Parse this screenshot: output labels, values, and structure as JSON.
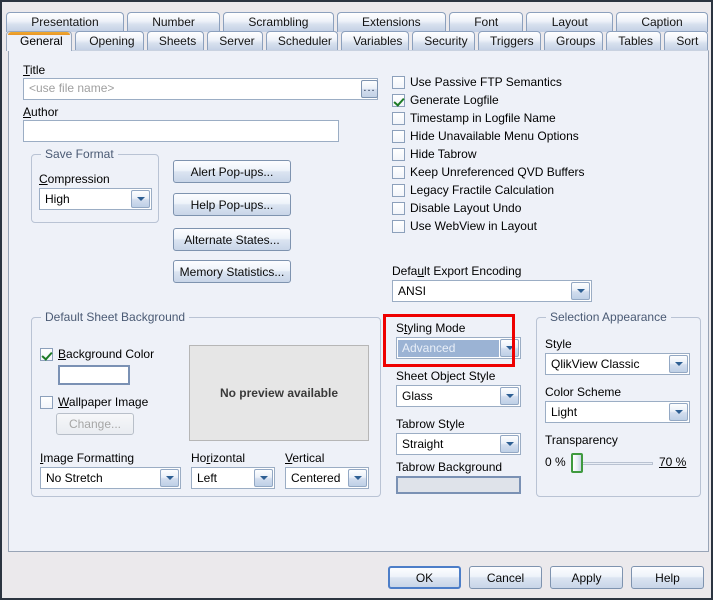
{
  "window": {
    "tabs_row_top": [
      "Presentation",
      "Number",
      "Scrambling",
      "Extensions",
      "Font",
      "Layout",
      "Caption"
    ],
    "tabs_row_bottom": [
      "General",
      "Opening",
      "Sheets",
      "Server",
      "Scheduler",
      "Variables",
      "Security",
      "Triggers",
      "Groups",
      "Tables",
      "Sort"
    ],
    "active_tab": "General"
  },
  "general": {
    "title_label": "Title",
    "title_value": "<use file name>",
    "title_browse": "...",
    "author_label": "Author",
    "author_value": "",
    "save_format": {
      "group_title": "Save Format",
      "compression_label": "Compression",
      "compression_value": "High"
    },
    "buttons": [
      "Alert Pop-ups...",
      "Help Pop-ups...",
      "Alternate States...",
      "Memory Statistics..."
    ],
    "checkboxes": [
      {
        "label": "Use Passive FTP Semantics",
        "checked": false
      },
      {
        "label": "Generate Logfile",
        "checked": true
      },
      {
        "label": "Timestamp in Logfile Name",
        "checked": false
      },
      {
        "label": "Hide Unavailable Menu Options",
        "checked": false
      },
      {
        "label": "Hide Tabrow",
        "checked": false
      },
      {
        "label": "Keep Unreferenced QVD Buffers",
        "checked": false
      },
      {
        "label": "Legacy Fractile Calculation",
        "checked": false
      },
      {
        "label": "Disable Layout Undo",
        "checked": false
      },
      {
        "label": "Use WebView in Layout",
        "checked": false
      }
    ],
    "export_encoding_label": "Default Export Encoding",
    "export_encoding_value": "ANSI"
  },
  "sheet_background": {
    "group_title": "Default Sheet Background",
    "background_color_label": "Background Color",
    "background_color_checked": true,
    "background_color_value": "#ffffff",
    "wallpaper_label": "Wallpaper Image",
    "wallpaper_checked": false,
    "change_button": "Change...",
    "preview_text": "No preview available",
    "image_formatting_label": "Image Formatting",
    "image_formatting_value": "No Stretch",
    "horizontal_label": "Horizontal",
    "horizontal_value": "Left",
    "vertical_label": "Vertical",
    "vertical_value": "Centered"
  },
  "styling": {
    "styling_mode_label": "Styling Mode",
    "styling_mode_value": "Advanced",
    "styling_mode_highlight_color": "#ee0000",
    "sheet_object_style_label": "Sheet Object Style",
    "sheet_object_style_value": "Glass",
    "tabrow_style_label": "Tabrow Style",
    "tabrow_style_value": "Straight",
    "tabrow_background_label": "Tabrow Background",
    "tabrow_background_value": "#dfe3ea"
  },
  "selection_appearance": {
    "group_title": "Selection Appearance",
    "style_label": "Style",
    "style_value": "QlikView Classic",
    "color_scheme_label": "Color Scheme",
    "color_scheme_value": "Light",
    "transparency_label": "Transparency",
    "transparency_min": "0 %",
    "transparency_max": "70 %"
  },
  "footer": {
    "ok": "OK",
    "cancel": "Cancel",
    "apply": "Apply",
    "help": "Help"
  }
}
